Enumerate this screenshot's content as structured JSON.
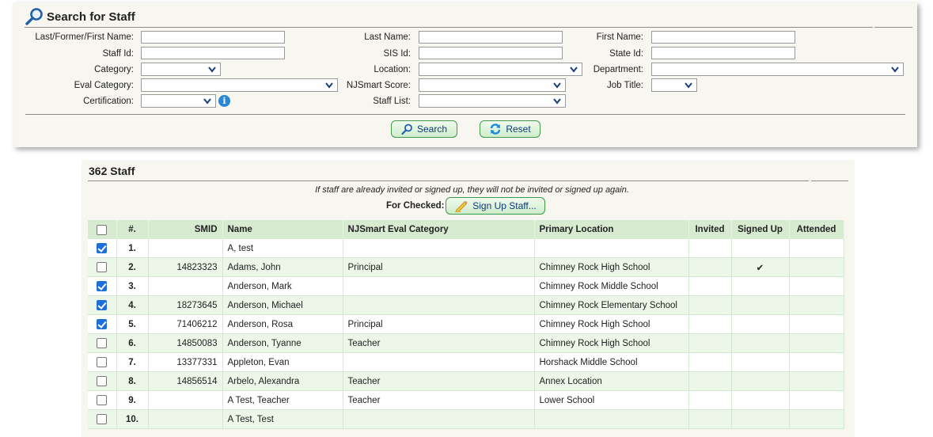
{
  "search": {
    "title": "Search for Staff",
    "fields": {
      "last_former_first": "Last/Former/First Name:",
      "last_name": "Last Name:",
      "first_name": "First Name:",
      "staff_id": "Staff Id:",
      "sis_id": "SIS Id:",
      "state_id": "State Id:",
      "category": "Category:",
      "location": "Location:",
      "department": "Department:",
      "eval_category": "Eval Category:",
      "njsmart_score": "NJSmart Score:",
      "job_title": "Job Title:",
      "certification": "Certification:",
      "staff_list": "Staff List:"
    },
    "search_button": "Search",
    "reset_button": "Reset"
  },
  "results": {
    "title": "362 Staff",
    "note": "If staff are already invited or signed up, they will not be invited or signed up again.",
    "for_checked_label": "For Checked:",
    "sign_up_button": "Sign Up Staff...",
    "columns": [
      "#.",
      "SMID",
      "Name",
      "NJSmart Eval Category",
      "Primary Location",
      "Invited",
      "Signed Up",
      "Attended"
    ],
    "rows": [
      {
        "checked": true,
        "num": "1.",
        "smid": "",
        "name": "A, test",
        "eval": "",
        "location": "",
        "invited": "",
        "signed_up": "",
        "attended": ""
      },
      {
        "checked": false,
        "num": "2.",
        "smid": "14823323",
        "name": "Adams, John",
        "eval": "Principal",
        "location": "Chimney Rock High School",
        "invited": "",
        "signed_up": "✔",
        "attended": ""
      },
      {
        "checked": true,
        "num": "3.",
        "smid": "",
        "name": "Anderson, Mark",
        "eval": "",
        "location": "Chimney Rock Middle School",
        "invited": "",
        "signed_up": "",
        "attended": ""
      },
      {
        "checked": true,
        "num": "4.",
        "smid": "18273645",
        "name": "Anderson, Michael",
        "eval": "",
        "location": "Chimney Rock Elementary School",
        "invited": "",
        "signed_up": "",
        "attended": ""
      },
      {
        "checked": true,
        "num": "5.",
        "smid": "71406212",
        "name": "Anderson, Rosa",
        "eval": "Principal",
        "location": "Chimney Rock High School",
        "invited": "",
        "signed_up": "",
        "attended": ""
      },
      {
        "checked": false,
        "num": "6.",
        "smid": "14850083",
        "name": "Anderson, Tyanne",
        "eval": "Teacher",
        "location": "Chimney Rock High School",
        "invited": "",
        "signed_up": "",
        "attended": ""
      },
      {
        "checked": false,
        "num": "7.",
        "smid": "13377331",
        "name": "Appleton, Evan",
        "eval": "",
        "location": "Horshack Middle School",
        "invited": "",
        "signed_up": "",
        "attended": ""
      },
      {
        "checked": false,
        "num": "8.",
        "smid": "14856514",
        "name": "Arbelo, Alexandra",
        "eval": "Teacher",
        "location": "Annex Location",
        "invited": "",
        "signed_up": "",
        "attended": ""
      },
      {
        "checked": false,
        "num": "9.",
        "smid": "",
        "name": "A Test, Teacher",
        "eval": "Teacher",
        "location": "Lower School",
        "invited": "",
        "signed_up": "",
        "attended": ""
      },
      {
        "checked": false,
        "num": "10.",
        "smid": "",
        "name": "A Test, Test",
        "eval": "",
        "location": "",
        "invited": "",
        "signed_up": "",
        "attended": ""
      }
    ]
  },
  "colors": {
    "panel_bg": "#f8f6f1",
    "header_green": "#d6ebcf",
    "row_alt_green": "#ecf6e9",
    "button_border": "#3f9a4a",
    "button_text": "#0d3a7a",
    "checkbox_blue": "#1e6fd9"
  },
  "icons": {
    "search_title": "magnifier-icon",
    "search_button": "magnifier-icon",
    "reset_button": "refresh-icon",
    "sign_up_button": "pencil-icon",
    "certification_info": "info-icon"
  }
}
